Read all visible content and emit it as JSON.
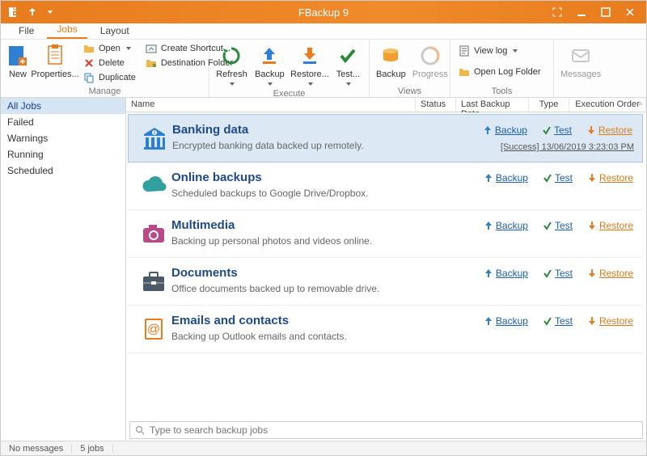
{
  "app": {
    "title": "FBackup 9"
  },
  "menu": {
    "tabs": [
      "File",
      "Jobs",
      "Layout"
    ],
    "active": 1
  },
  "ribbon": {
    "new": "New",
    "properties": "Properties...",
    "open": "Open",
    "delete": "Delete",
    "duplicate": "Duplicate",
    "create_shortcut": "Create Shortcut...",
    "destination_folder": "Destination Folder",
    "refresh": "Refresh",
    "backup": "Backup",
    "restore": "Restore...",
    "test": "Test...",
    "backup_view": "Backup",
    "progress": "Progress",
    "view_log": "View log",
    "open_log_folder": "Open Log Folder",
    "messages": "Messages",
    "groups": {
      "manage": "Manage",
      "execute": "Execute",
      "views": "Views",
      "tools": "Tools"
    }
  },
  "sidebar": {
    "items": [
      "All Jobs",
      "Failed",
      "Warnings",
      "Running",
      "Scheduled"
    ],
    "active": 0
  },
  "columns": {
    "name": "Name",
    "status": "Status",
    "last": "Last Backup Date",
    "type": "Type",
    "exec": "Execution Order"
  },
  "actions": {
    "backup": "Backup",
    "test": "Test",
    "restore": "Restore"
  },
  "jobs": [
    {
      "title": "Banking data",
      "desc": "Encrypted banking data backed up remotely.",
      "status": "[Success] 13/06/2019 3:23:03 PM",
      "icon": "bank",
      "color": "#2f7fd4",
      "selected": true
    },
    {
      "title": "Online backups",
      "desc": "Scheduled backups to Google Drive/Dropbox.",
      "icon": "cloud",
      "color": "#33a0a0"
    },
    {
      "title": "Multimedia",
      "desc": "Backing up personal photos and videos online.",
      "icon": "camera",
      "color": "#b84a8a"
    },
    {
      "title": "Documents",
      "desc": "Office documents backed up to removable drive.",
      "icon": "briefcase",
      "color": "#4a5a66"
    },
    {
      "title": "Emails and contacts",
      "desc": "Backing up Outlook emails and contacts.",
      "icon": "contacts",
      "color": "#e87c1e"
    }
  ],
  "search": {
    "placeholder": "Type to search backup jobs"
  },
  "statusbar": {
    "messages": "No messages",
    "jobs": "5 jobs"
  }
}
